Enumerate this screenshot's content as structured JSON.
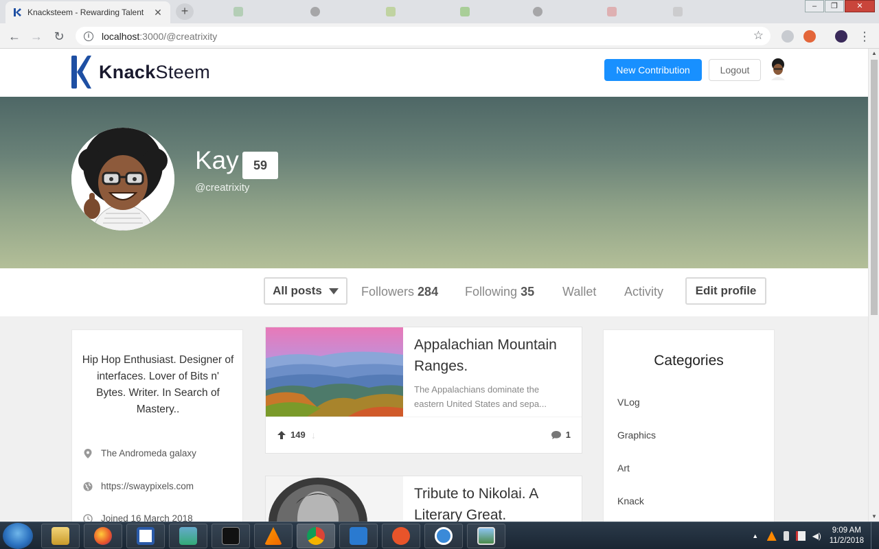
{
  "browser": {
    "tab_title": "Knacksteem - Rewarding Talent",
    "tab_close": "✕",
    "new_tab": "+",
    "url_host": "localhost",
    "url_path": ":3000/@creatrixity"
  },
  "header": {
    "logo_word_bold": "Knack",
    "logo_word_light": "Steem",
    "new_contribution_label": "New Contribution",
    "logout_label": "Logout"
  },
  "profile": {
    "name": "Kay",
    "reputation": "59",
    "handle": "@creatrixity"
  },
  "profile_menu": {
    "all_posts_label": "All posts",
    "followers_label": "Followers",
    "followers_count": "284",
    "following_label": "Following",
    "following_count": "35",
    "wallet_label": "Wallet",
    "activity_label": "Activity",
    "edit_profile_label": "Edit profile"
  },
  "about": {
    "bio": "Hip Hop Enthusiast. Designer of interfaces. Lover of Bits n' Bytes. Writer. In Search of Mastery..",
    "location": "The Andromeda galaxy",
    "website": "https://swaypixels.com",
    "joined": "Joined 16 March 2018",
    "icons": [
      "location-pin-icon",
      "globe-icon",
      "clock-icon"
    ]
  },
  "posts": [
    {
      "title": "Appalachian Mountain Ranges.",
      "excerpt": "The Appalachians dominate the eastern United States and sepa...",
      "upvotes": "149",
      "comments": "1"
    },
    {
      "title": "Tribute to Nikolai. A Literary Great."
    }
  ],
  "categories": {
    "title": "Categories",
    "items": [
      "VLog",
      "Graphics",
      "Art",
      "Knack"
    ]
  },
  "taskbar": {
    "time": "9:09 AM",
    "date": "11/2/2018"
  },
  "colors": {
    "primary": "#1890ff",
    "cover_top": "#4e6766",
    "cover_bottom": "#b3bf98",
    "logo_blue": "#1e4fa3"
  }
}
